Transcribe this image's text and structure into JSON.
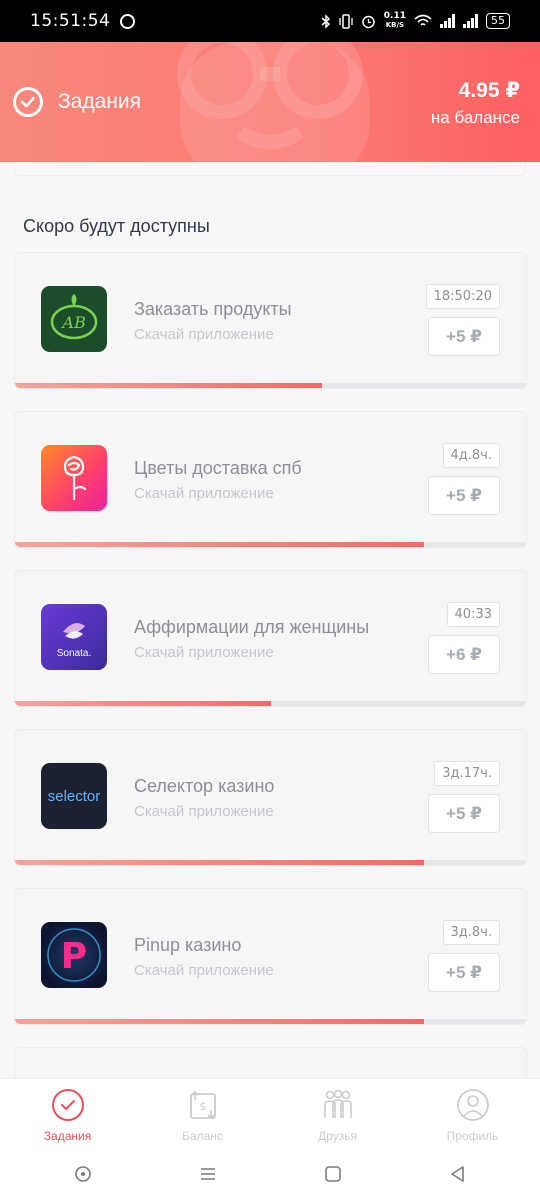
{
  "status_bar": {
    "time": "15:51:54",
    "speed_top": "0.11",
    "speed_unit": "KB/S",
    "battery": "55"
  },
  "header": {
    "title": "Задания",
    "balance_amount": "4.95 ₽",
    "balance_label": "на балансе"
  },
  "section_title": "Скоро будут доступны",
  "tasks": [
    {
      "name": "Заказать продукты",
      "subtitle": "Скачай приложение",
      "timer": "18:50:20",
      "reward": "+5 ₽",
      "progress": 0.6,
      "icon": "azbuka-vkusa-icon"
    },
    {
      "name": "Цветы доставка спб",
      "subtitle": "Скачай приложение",
      "timer": "4д.8ч.",
      "reward": "+5 ₽",
      "progress": 0.8,
      "icon": "rose-flowers-icon"
    },
    {
      "name": "Аффирмации для женщины",
      "subtitle": "Скачай приложение",
      "timer": "40:33",
      "reward": "+6 ₽",
      "progress": 0.5,
      "icon": "sonata-icon",
      "icon_text": "Sonata."
    },
    {
      "name": "Селектор казино",
      "subtitle": "Скачай приложение",
      "timer": "3д.17ч.",
      "reward": "+5 ₽",
      "progress": 0.8,
      "icon": "selector-icon",
      "icon_text": "selector"
    },
    {
      "name": "Pinup казино",
      "subtitle": "Скачай приложение",
      "timer": "3д.8ч.",
      "reward": "+5 ₽",
      "progress": 0.8,
      "icon": "pinup-icon",
      "icon_text": "P"
    }
  ],
  "bottom_nav": [
    {
      "label": "Задания",
      "icon": "tasks-check-icon",
      "active": true
    },
    {
      "label": "Баланс",
      "icon": "balance-transfer-icon",
      "active": false
    },
    {
      "label": "Друзья",
      "icon": "friends-icon",
      "active": false
    },
    {
      "label": "Профиль",
      "icon": "profile-icon",
      "active": false
    }
  ],
  "colors": {
    "accent": "#e8505b",
    "header_start": "#f8877b",
    "header_end": "#fe5f60"
  }
}
